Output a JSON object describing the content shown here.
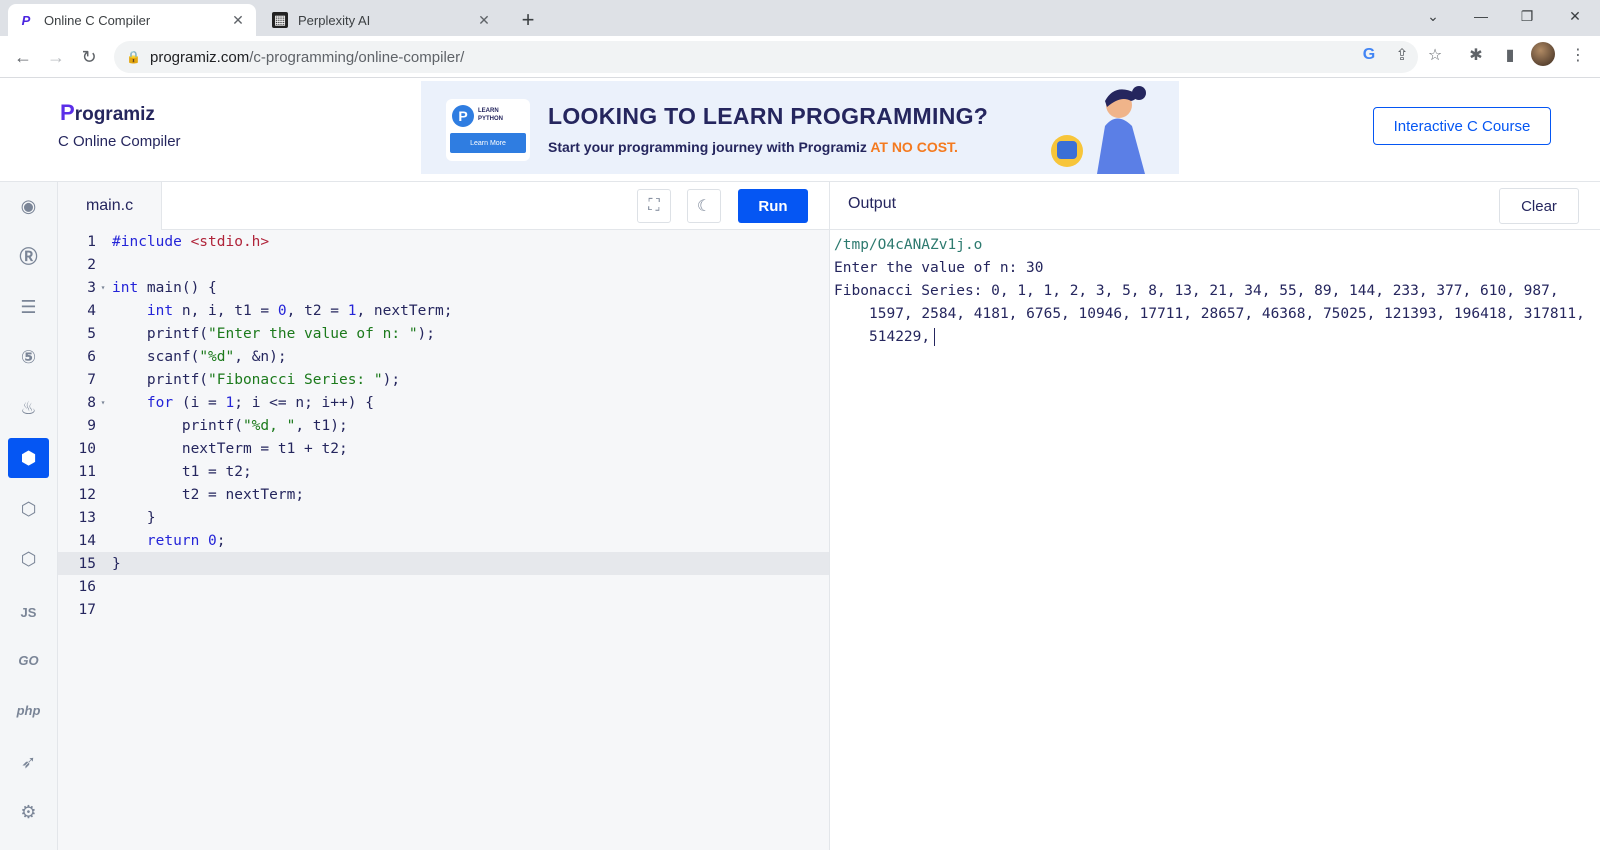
{
  "browser": {
    "tabs": [
      {
        "title": "Online C Compiler",
        "active": true,
        "favicon": "programiz-icon"
      },
      {
        "title": "Perplexity AI",
        "active": false,
        "favicon": "perplexity-icon"
      }
    ],
    "url_host": "programiz.com",
    "url_path": "/c-programming/online-compiler/"
  },
  "site": {
    "logo_text": "rogramiz",
    "logo_letter": "P",
    "subtitle": "C Online Compiler",
    "banner": {
      "card_label_1": "LEARN",
      "card_label_2": "PYTHON",
      "card_button": "Learn More",
      "headline": "LOOKING TO LEARN PROGRAMMING?",
      "sub_text": "Start your programming journey with Programiz ",
      "sub_highlight": "AT NO COST."
    },
    "course_button": "Interactive C Course"
  },
  "rail": {
    "items": [
      {
        "name": "python",
        "glyph": "🐍"
      },
      {
        "name": "r",
        "glyph": "R"
      },
      {
        "name": "sql",
        "glyph": "🛢"
      },
      {
        "name": "html",
        "glyph": "5"
      },
      {
        "name": "java",
        "glyph": "☕"
      },
      {
        "name": "c",
        "glyph": "C",
        "active": true
      },
      {
        "name": "cpp",
        "glyph": "C"
      },
      {
        "name": "csharp",
        "glyph": "C"
      },
      {
        "name": "js",
        "glyph": "JS"
      },
      {
        "name": "go",
        "glyph": "GO"
      },
      {
        "name": "php",
        "glyph": "php"
      },
      {
        "name": "swift",
        "glyph": "⟁"
      },
      {
        "name": "rust",
        "glyph": "R"
      }
    ]
  },
  "editor": {
    "file_name": "main.c",
    "run_label": "Run",
    "current_line": 15
  },
  "output": {
    "title": "Output",
    "clear_label": "Clear",
    "path": "/tmp/O4cANAZv1j.o",
    "prompt_line": "Enter the value of n: 30",
    "series_line": "Fibonacci Series: 0, 1, 1, 2, 3, 5, 8, 13, 21, 34, 55, 89, 144, 233, 377, 610, 987,",
    "series_cont_1": "1597, 2584, 4181, 6765, 10946, 17711, 28657, 46368, 75025, 121393, 196418, 317811,",
    "series_cont_2": "514229,"
  }
}
